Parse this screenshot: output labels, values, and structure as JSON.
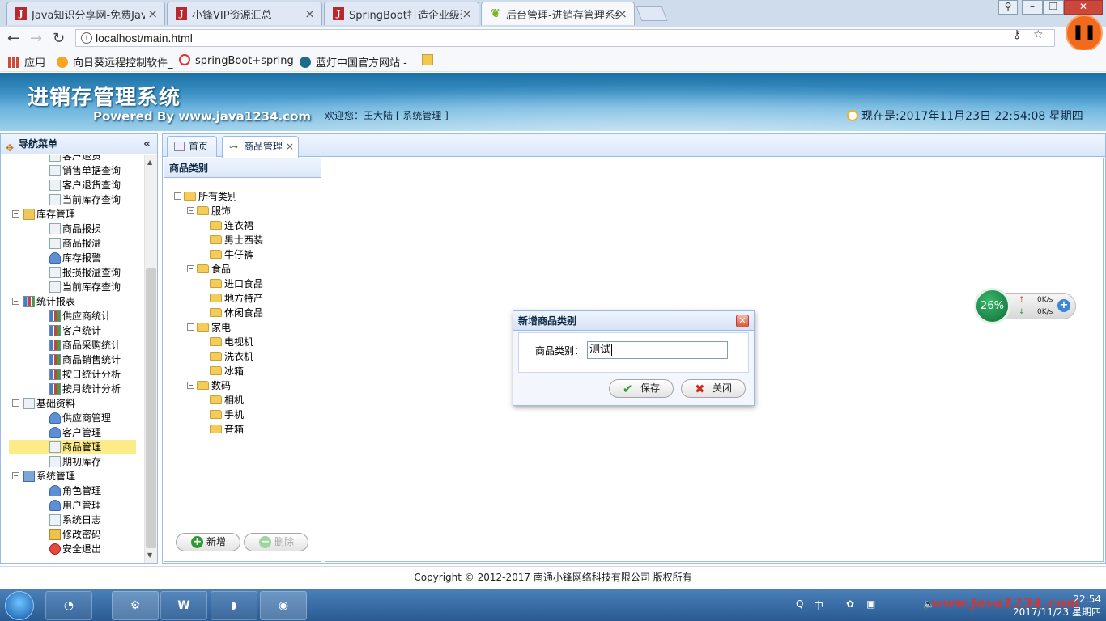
{
  "browser": {
    "tabs": [
      {
        "title": "Java知识分享网-免费Jav",
        "favicon": "J"
      },
      {
        "title": "小锋VIP资源汇总",
        "favicon": "J"
      },
      {
        "title": "SpringBoot打造企业级进",
        "favicon": "J"
      },
      {
        "title": "后台管理-进销存管理系统",
        "favicon": "leaf"
      }
    ],
    "url": "localhost/main.html",
    "bookmarks": [
      "应用",
      "向日葵远程控制软件_",
      "springBoot+spring",
      "蓝灯中国官方网站 - "
    ]
  },
  "header": {
    "title": "进销存管理系统",
    "subtitle": "Powered By www.java1234.com",
    "welcome": "欢迎您：王大陆 [ 系统管理 ]",
    "datetime": "现在是:2017年11月23日 22:54:08 星期四"
  },
  "nav": {
    "title": "导航菜单",
    "items": [
      {
        "label": "客户退货",
        "level": 2,
        "icon": "doc"
      },
      {
        "label": "销售单据查询",
        "level": 2,
        "icon": "doc"
      },
      {
        "label": "客户退货查询",
        "level": 2,
        "icon": "doc"
      },
      {
        "label": "当前库存查询",
        "level": 2,
        "icon": "doc"
      },
      {
        "label": "库存管理",
        "level": 1,
        "icon": "folder"
      },
      {
        "label": "商品报损",
        "level": 2,
        "icon": "doc"
      },
      {
        "label": "商品报溢",
        "level": 2,
        "icon": "doc"
      },
      {
        "label": "库存报警",
        "level": 2,
        "icon": "person"
      },
      {
        "label": "报损报溢查询",
        "level": 2,
        "icon": "doc"
      },
      {
        "label": "当前库存查询",
        "level": 2,
        "icon": "doc"
      },
      {
        "label": "统计报表",
        "level": 1,
        "icon": "chart"
      },
      {
        "label": "供应商统计",
        "level": 2,
        "icon": "chart"
      },
      {
        "label": "客户统计",
        "level": 2,
        "icon": "chart"
      },
      {
        "label": "商品采购统计",
        "level": 2,
        "icon": "chart"
      },
      {
        "label": "商品销售统计",
        "level": 2,
        "icon": "chart"
      },
      {
        "label": "按日统计分析",
        "level": 2,
        "icon": "chart"
      },
      {
        "label": "按月统计分析",
        "level": 2,
        "icon": "chart"
      },
      {
        "label": "基础资料",
        "level": 1,
        "icon": "doc"
      },
      {
        "label": "供应商管理",
        "level": 2,
        "icon": "person"
      },
      {
        "label": "客户管理",
        "level": 2,
        "icon": "person"
      },
      {
        "label": "商品管理",
        "level": 2,
        "icon": "tree",
        "selected": true
      },
      {
        "label": "期初库存",
        "level": 2,
        "icon": "doc"
      },
      {
        "label": "系统管理",
        "level": 1,
        "icon": "monitor"
      },
      {
        "label": "角色管理",
        "level": 2,
        "icon": "person"
      },
      {
        "label": "用户管理",
        "level": 2,
        "icon": "person"
      },
      {
        "label": "系统日志",
        "level": 2,
        "icon": "doc"
      },
      {
        "label": "修改密码",
        "level": 2,
        "icon": "lock"
      },
      {
        "label": "安全退出",
        "level": 2,
        "icon": "red"
      }
    ]
  },
  "content_tabs": [
    {
      "label": "首页"
    },
    {
      "label": "商品管理",
      "close": "×"
    }
  ],
  "category_panel": {
    "title": "商品类别",
    "tree": [
      {
        "label": "所有类别",
        "level": 0
      },
      {
        "label": "服饰",
        "level": 1
      },
      {
        "label": "连衣裙",
        "level": 2
      },
      {
        "label": "男士西装",
        "level": 2
      },
      {
        "label": "牛仔裤",
        "level": 2
      },
      {
        "label": "食品",
        "level": 1
      },
      {
        "label": "进口食品",
        "level": 2
      },
      {
        "label": "地方特产",
        "level": 2
      },
      {
        "label": "休闲食品",
        "level": 2
      },
      {
        "label": "家电",
        "level": 1
      },
      {
        "label": "电视机",
        "level": 2
      },
      {
        "label": "洗衣机",
        "level": 2
      },
      {
        "label": "冰箱",
        "level": 2
      },
      {
        "label": "数码",
        "level": 1
      },
      {
        "label": "相机",
        "level": 2
      },
      {
        "label": "手机",
        "level": 2
      },
      {
        "label": "音箱",
        "level": 2
      }
    ],
    "add_label": "新增",
    "delete_label": "删除"
  },
  "dialog": {
    "title": "新增商品类别",
    "field_label": "商品类别：",
    "field_value": "测试",
    "save_label": "保存",
    "close_label": "关闭"
  },
  "footer": {
    "copyright": "Copyright © 2012-2017 南通小锋网络科技有限公司 版权所有"
  },
  "net_widget": {
    "percent": "26%",
    "up": "0K/s",
    "down": "0K/s"
  },
  "taskbar": {
    "time": "22:54",
    "date": "2017/11/23 星期四",
    "ime": "中",
    "watermark": "www.java1234.com"
  },
  "colors": {
    "panel_border": "#99bbe8",
    "selected_row": "#fbec88",
    "header_blue": "#3b90c4"
  }
}
